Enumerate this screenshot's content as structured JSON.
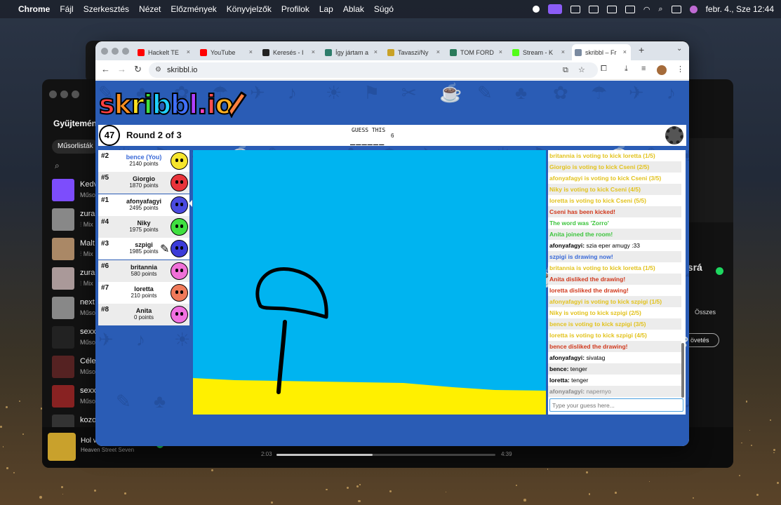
{
  "menubar": {
    "app": "Chrome",
    "menus": [
      "Fájl",
      "Szerkesztés",
      "Nézet",
      "Előzmények",
      "Könyvjelzők",
      "Profilok",
      "Lap",
      "Ablak",
      "Súgó"
    ],
    "clock": "febr. 4., Sze  12:44"
  },
  "spotify": {
    "library_title": "Gyűjtemény",
    "chip": "Műsorlisták",
    "items": [
      {
        "t1": "Kedv",
        "t2": "Műso",
        "color": "#7d4dfc"
      },
      {
        "t1": "zura",
        "t2": "⫶ Mix",
        "color": "#888"
      },
      {
        "t1": "Malt",
        "t2": "⫶ Mix",
        "color": "#a86"
      },
      {
        "t1": "zura",
        "t2": "⫶ Mix",
        "color": "#a99"
      },
      {
        "t1": "next",
        "t2": "Műso",
        "color": "#888"
      },
      {
        "t1": "sexx",
        "t2": "Műso",
        "color": "#222"
      },
      {
        "t1": "Céle",
        "t2": "Műso",
        "color": "#522"
      },
      {
        "t1": "sexx",
        "t2": "Műso",
        "color": "#822"
      },
      {
        "t1": "kozo",
        "t2": "",
        "color": "#333"
      }
    ],
    "song": "Hol van",
    "artist": "Heaven Street Seven",
    "elapsed": "2:03",
    "duration": "4:39",
    "progress": 0.44,
    "right_label_1": "Összes",
    "right_label_2": "övetés",
    "right_title": "zi srá",
    "album_text": "heaven street seven"
  },
  "chrome": {
    "tabs": [
      {
        "label": "Hackelt TE",
        "color": "#ff0000",
        "active": false
      },
      {
        "label": "YouTube",
        "color": "#ff0000",
        "active": false
      },
      {
        "label": "Keresés - I",
        "color": "#222222",
        "active": false
      },
      {
        "label": "Így jártam a",
        "color": "#2e7d6b",
        "active": false
      },
      {
        "label": "Tavaszi/Ny",
        "color": "#c9a227",
        "active": false
      },
      {
        "label": "TOM FORD",
        "color": "#2a7a5a",
        "active": false
      },
      {
        "label": "Stream - K",
        "color": "#53fc18",
        "active": false
      },
      {
        "label": "skribbl – Fr",
        "color": "#7a8aa0",
        "active": true
      }
    ],
    "url": "skribbl.io"
  },
  "game": {
    "logo": "skribbl.io",
    "logo_colors": [
      "#ff4040",
      "#ff9020",
      "#ffe020",
      "#40e040",
      "#20d0ff",
      "#4070ff",
      "#b040ff",
      "#ff40c0",
      "#ff5050",
      "#ffb020"
    ],
    "timer": "47",
    "round": "Round 2 of 3",
    "guess_label": "GUESS THIS",
    "hint": "______",
    "word_length": "6",
    "players": [
      {
        "rank": "#2",
        "name": "bence (You)",
        "points": "2140 points",
        "color": "#f6e52d",
        "you": true,
        "drawing": false
      },
      {
        "rank": "#5",
        "name": "Giorgio",
        "points": "1870 points",
        "color": "#e8333a",
        "you": false,
        "drawing": false
      },
      {
        "rank": "#1",
        "name": "afonyafagyi",
        "points": "2495 points",
        "color": "#4a4ae0",
        "you": false,
        "drawing": false
      },
      {
        "rank": "#4",
        "name": "Niky",
        "points": "1975 points",
        "color": "#40e040",
        "you": false,
        "drawing": false
      },
      {
        "rank": "#3",
        "name": "szpigi",
        "points": "1985 points",
        "color": "#3b3bd8",
        "you": false,
        "drawing": true
      },
      {
        "rank": "#6",
        "name": "britannia",
        "points": "580 points",
        "color": "#f070d8",
        "you": false,
        "drawing": false
      },
      {
        "rank": "#7",
        "name": "loretta",
        "points": "210 points",
        "color": "#f07a5a",
        "you": false,
        "drawing": false
      },
      {
        "rank": "#8",
        "name": "Anita",
        "points": "0 points",
        "color": "#f070e0",
        "you": false,
        "drawing": false
      }
    ],
    "bubble": "napernyo",
    "chat": [
      {
        "text": "britannia is voting to kick loretta (1/5)",
        "color": "#e2c21c"
      },
      {
        "text": "Giorgio is voting to kick Cseni (2/5)",
        "color": "#e2c21c"
      },
      {
        "text": "afonyafagyi is voting to kick Cseni (3/5)",
        "color": "#e2c21c"
      },
      {
        "text": "Niky is voting to kick Cseni (4/5)",
        "color": "#e2c21c"
      },
      {
        "text": "loretta is voting to kick Cseni (5/5)",
        "color": "#e2c21c"
      },
      {
        "text": "Cseni has been kicked!",
        "color": "#d0381c"
      },
      {
        "text": "The word was 'Zorro'",
        "color": "#3cc43c"
      },
      {
        "text": "Anita joined the room!",
        "color": "#3cc43c"
      },
      {
        "who": "afonyafagyi:",
        "text": " szia eper amugy :33",
        "color": "#000"
      },
      {
        "text": "szpigi is drawing now!",
        "color": "#3a6ad8"
      },
      {
        "text": "britannia is voting to kick loretta (1/5)",
        "color": "#e2c21c"
      },
      {
        "text": "Anita disliked the drawing!",
        "color": "#d0381c"
      },
      {
        "text": "loretta disliked the drawing!",
        "color": "#d0381c"
      },
      {
        "text": "afonyafagyi is voting to kick szpigi (1/5)",
        "color": "#e2c21c"
      },
      {
        "text": "Niky is voting to kick szpigi (2/5)",
        "color": "#e2c21c"
      },
      {
        "text": "bence is voting to kick szpigi (3/5)",
        "color": "#e2c21c"
      },
      {
        "text": "loretta is voting to kick szpigi (4/5)",
        "color": "#e2c21c"
      },
      {
        "text": "bence disliked the drawing!",
        "color": "#d0381c"
      },
      {
        "who": "afonyafagyi:",
        "text": " sivatag",
        "color": "#000"
      },
      {
        "who": "bence:",
        "text": " tenger",
        "color": "#000"
      },
      {
        "who": "loretta:",
        "text": " tenger",
        "color": "#000"
      },
      {
        "who": "afonyafagyi:",
        "text": " napernyo",
        "color": "#000",
        "faded": true
      }
    ],
    "chat_placeholder": "Type your guess here..."
  }
}
